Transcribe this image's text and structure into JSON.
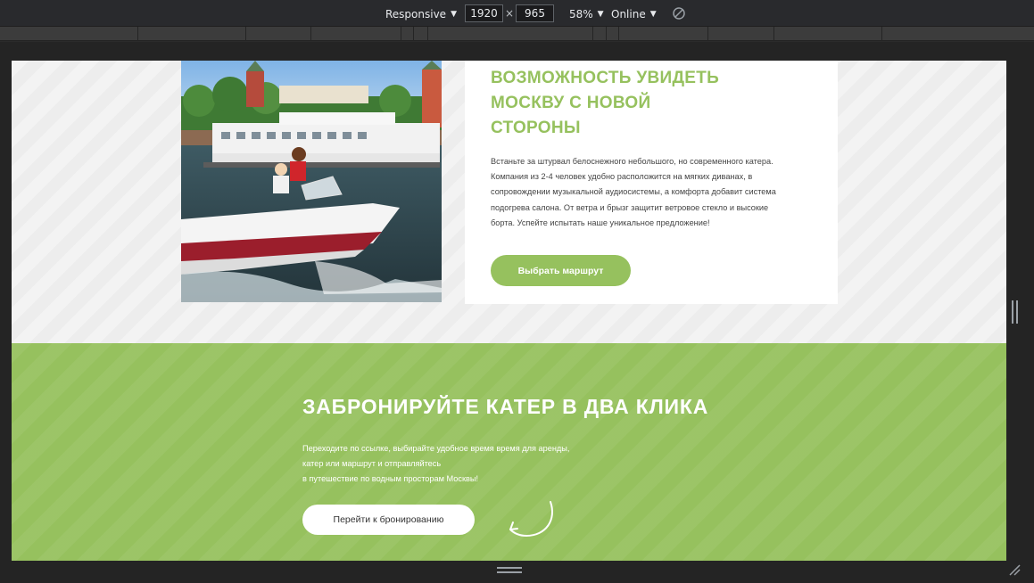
{
  "devtools": {
    "device_mode": "Responsive",
    "width": "1920",
    "height": "965",
    "times": "×",
    "zoom": "58%",
    "network": "Online"
  },
  "feature": {
    "title": "ВОЗМОЖНОСТЬ УВИДЕТЬ МОСКВУ С НОВОЙ СТОРОНЫ",
    "description": "Встаньте за штурвал белоснежного небольшого, но современного катера. Компания из 2-4 человек удобно расположится на мягких диванах, в сопровождении музыкальной аудиосистемы, а комфорта добавит система подогрева салона. От ветра и брызг защитит ветровое стекло и высокие борта. Успейте испытать наше уникальное предложение!",
    "button": "Выбрать маршрут"
  },
  "booking": {
    "title": "ЗАБРОНИРУЙТЕ КАТЕР В ДВА КЛИКА",
    "lines": [
      "Переходите по ссылке, выбирайте удобное время время для аренды,",
      "катер или маршрут и отправляйтесь",
      "в путешествие по водным просторам Москвы!"
    ],
    "button": "Перейти к бронированию"
  },
  "colors": {
    "accent": "#96c15e",
    "toolbar": "#292a2d",
    "section_bg": "#ededed"
  }
}
